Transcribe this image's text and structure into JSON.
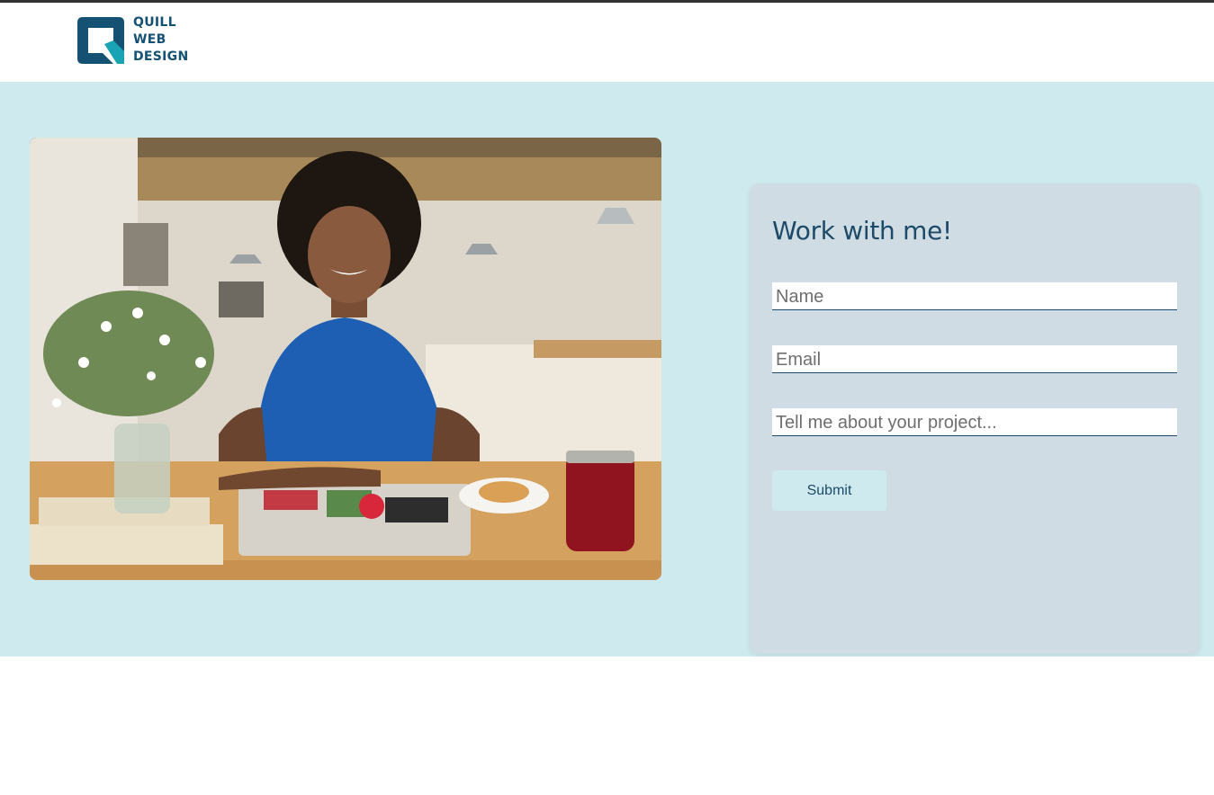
{
  "brand": {
    "name_lines": [
      "QUILL",
      "WEB",
      "DESIGN"
    ],
    "logo_icon": "quill-q-logo",
    "colors": {
      "primary": "#145173",
      "accent": "#1aa3b5"
    }
  },
  "hero": {
    "background": "#ceeaee",
    "photo_icon": "portrait-photo"
  },
  "contact_form": {
    "title": "Work with me!",
    "fields": {
      "name_placeholder": "Name",
      "email_placeholder": "Email",
      "project_placeholder": "Tell me about your project..."
    },
    "submit_label": "Submit"
  }
}
